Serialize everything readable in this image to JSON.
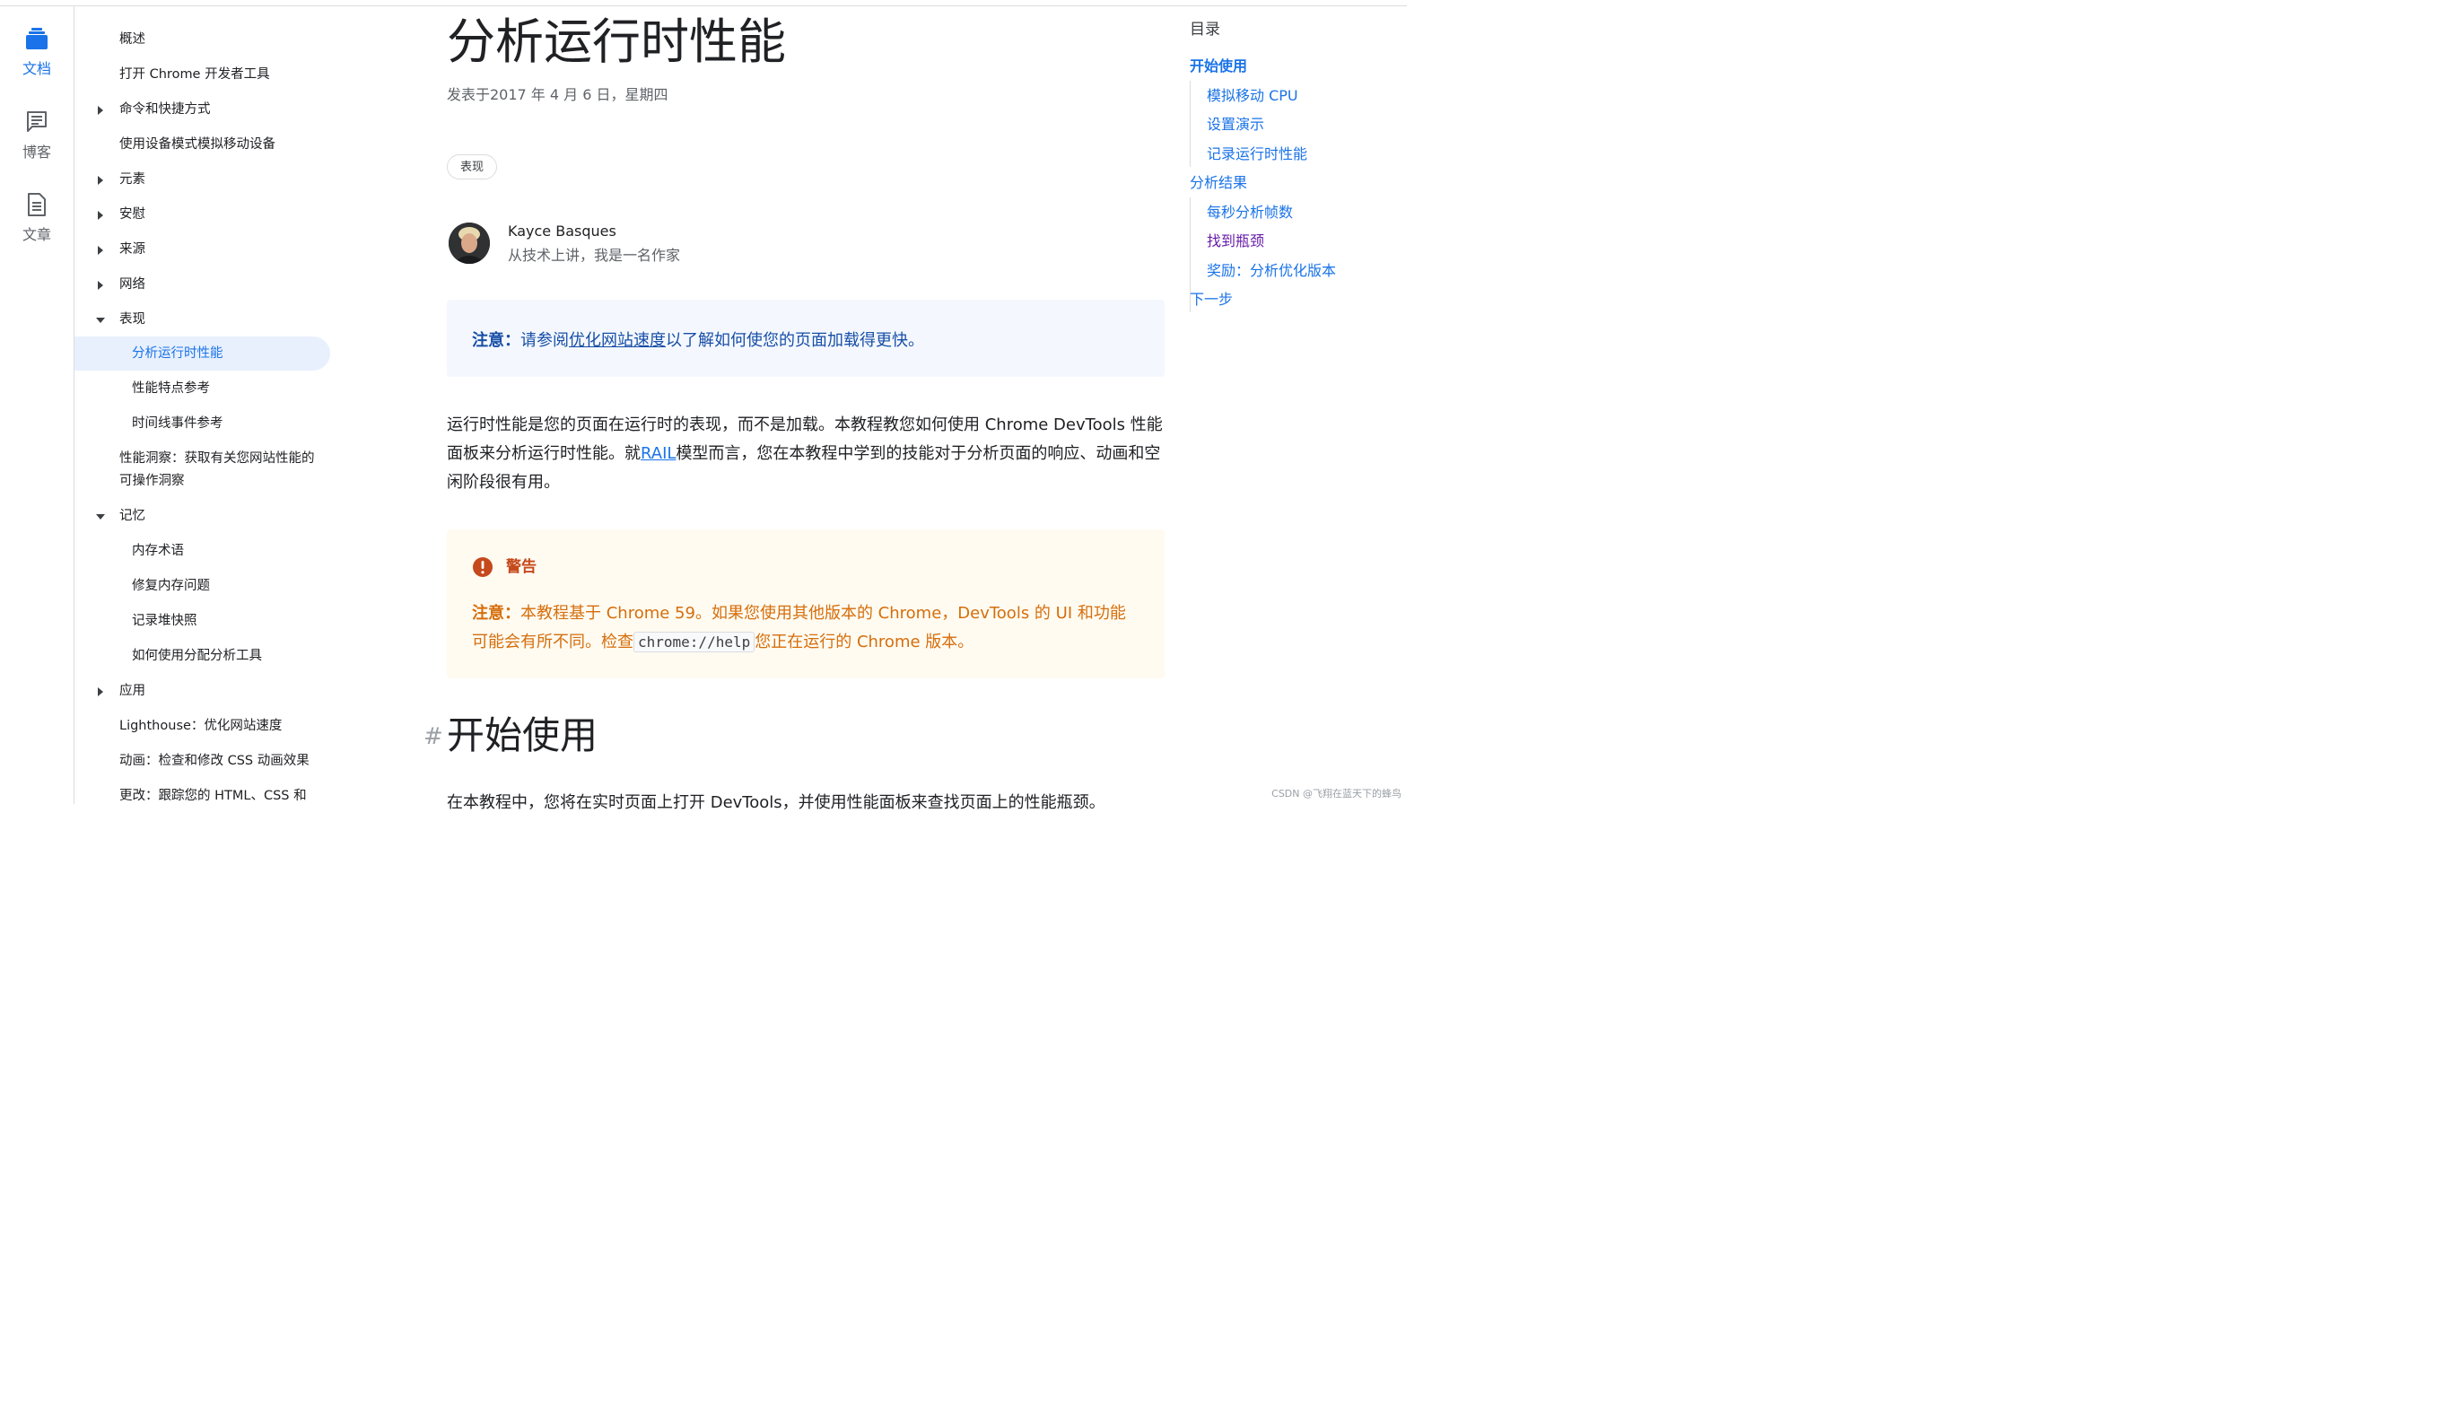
{
  "rail": [
    {
      "label": "文档",
      "icon": "docs-stack-icon",
      "active": true
    },
    {
      "label": "博客",
      "icon": "chat-bubble-icon",
      "active": false
    },
    {
      "label": "文章",
      "icon": "article-icon",
      "active": false
    }
  ],
  "sidenav": {
    "items": [
      {
        "label": "概述"
      },
      {
        "label": "打开 Chrome 开发者工具"
      },
      {
        "label": "命令和快捷方式"
      },
      {
        "label": "使用设备模式模拟移动设备"
      },
      {
        "label": "元素"
      },
      {
        "label": "安慰"
      },
      {
        "label": "来源"
      },
      {
        "label": "网络"
      },
      {
        "label": "表现"
      },
      {
        "label": "分析运行时性能"
      },
      {
        "label": "性能特点参考"
      },
      {
        "label": "时间线事件参考"
      },
      {
        "label": "性能洞察：获取有关您网站性能的"
      },
      {
        "label": "可操作洞察"
      },
      {
        "label": "记忆"
      },
      {
        "label": "内存术语"
      },
      {
        "label": "修复内存问题"
      },
      {
        "label": "记录堆快照"
      },
      {
        "label": "如何使用分配分析工具"
      },
      {
        "label": "应用"
      },
      {
        "label": "Lighthouse：优化网站速度"
      },
      {
        "label": "动画：检查和修改 CSS 动画效果"
      },
      {
        "label": "更改：跟踪您的 HTML、CSS 和"
      }
    ]
  },
  "article": {
    "title": "分析运行时性能",
    "date": "发表于2017 年 4 月 6 日，星期四",
    "tag": "表现",
    "author_name": "Kayce Basques",
    "author_desc": "从技术上讲，我是一名作家",
    "note_label": "注意：",
    "note_prefix": "请参阅",
    "note_link": "优化网站速度",
    "note_suffix": "以了解如何使您的页面加载得更快。",
    "para_1": "运行时性能是您的页面在运行时的表现，而不是加载。本教程教您如何使用 Chrome DevTools 性能面板来分析运行时性能。就",
    "para_link": "RAIL",
    "para_2": "模型而言，您在本教程中学到的技能对于分析页面的响应、动画和空闲阶段很有用。",
    "warning_title": "警告",
    "warning_label": "注意：",
    "warning_text_1": "本教程基于 Chrome 59。如果您使用其他版本的 Chrome，DevTools 的 UI 和功能可能会有所不同。检查",
    "warning_code": "chrome://help",
    "warning_text_2": "您正在运行的 Chrome 版本。",
    "h2_hash": "#",
    "h2": "开始使用",
    "cut_text": "在本教程中，您将在实时页面上打开 DevTools，并使用性能面板来查找页面上的性能瓶颈。"
  },
  "toc": {
    "title": "目录",
    "items": [
      {
        "label": "开始使用"
      },
      {
        "label": "模拟移动 CPU"
      },
      {
        "label": "设置演示"
      },
      {
        "label": "记录运行时性能"
      },
      {
        "label": "分析结果"
      },
      {
        "label": "每秒分析帧数"
      },
      {
        "label": "找到瓶颈"
      },
      {
        "label": "奖励：分析优化版本"
      },
      {
        "label": "下一步"
      }
    ]
  },
  "watermark": "CSDN @飞翔在蓝天下的蜂鸟",
  "colors": {
    "accent": "#1a73e8",
    "note_text": "#174ea6",
    "warning": "#d56e0c",
    "visited": "#681da8"
  }
}
